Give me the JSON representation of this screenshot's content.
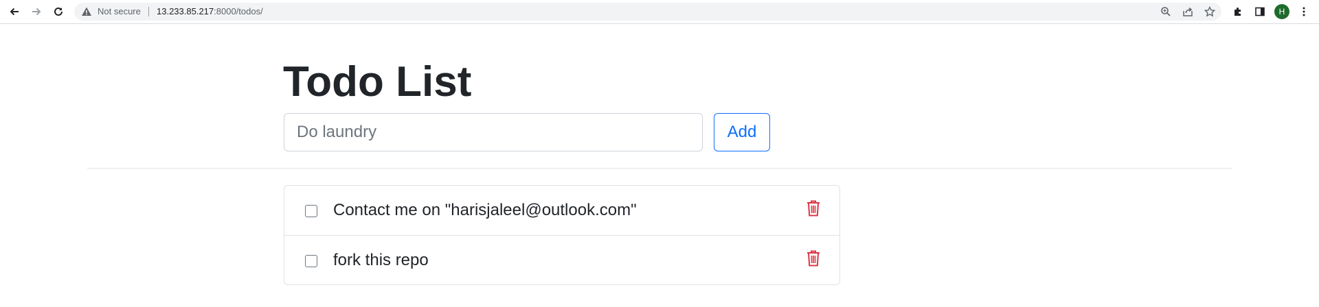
{
  "browser": {
    "security_label": "Not secure",
    "url_host": "13.233.85.217",
    "url_rest": ":8000/todos/",
    "profile_initial": "H",
    "icons": [
      "back-icon",
      "forward-icon",
      "reload-icon",
      "warning-icon",
      "zoom-icon",
      "share-icon",
      "star-icon",
      "extensions-icon",
      "side-panel-icon",
      "menu-icon"
    ]
  },
  "page": {
    "title": "Todo List",
    "input_placeholder": "Do laundry",
    "add_label": "Add"
  },
  "todos": [
    {
      "text": "Contact me on \"harisjaleel@outlook.com\"",
      "checked": false
    },
    {
      "text": "fork this repo",
      "checked": false
    }
  ],
  "colors": {
    "primary": "#0d6efd",
    "danger": "#dc3545",
    "text": "#212529",
    "border": "#dee2e6"
  }
}
